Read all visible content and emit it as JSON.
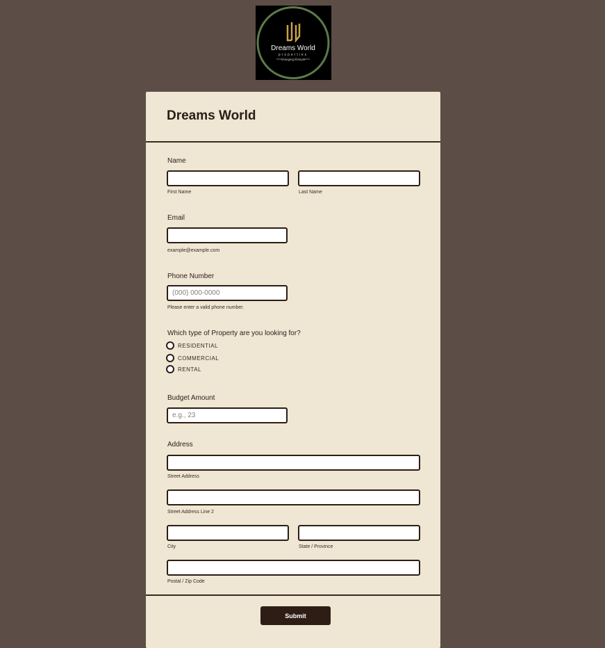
{
  "logo": {
    "text": "Dreams World",
    "subtitle": "properties",
    "tagline": "changing lifestyle"
  },
  "form": {
    "title": "Dreams World"
  },
  "fields": {
    "name": {
      "label": "Name",
      "first_sub": "First Name",
      "last_sub": "Last Name"
    },
    "email": {
      "label": "Email",
      "sub": "example@example.com"
    },
    "phone": {
      "label": "Phone Number",
      "placeholder": "(000) 000-0000",
      "sub": "Please enter a valid phone number."
    },
    "property": {
      "label": "Which type of Property are you looking for?",
      "options": [
        "RESIDENTIAL",
        "COMMERCIAL",
        "RENTAL"
      ]
    },
    "budget": {
      "label": "Budget Amount",
      "placeholder": "e.g., 23"
    },
    "address": {
      "label": "Address",
      "street_sub": "Street Address",
      "street2_sub": "Street Address Line 2",
      "city_sub": "City",
      "state_sub": "State / Province",
      "zip_sub": "Postal / Zip Code"
    }
  },
  "submit_label": "Submit",
  "colors": {
    "background": "#5c4d46",
    "card": "#efe6d3",
    "accent": "#2e1d15",
    "logo_ring": "#5c7a4a",
    "logo_gold": "#c9a24a"
  }
}
